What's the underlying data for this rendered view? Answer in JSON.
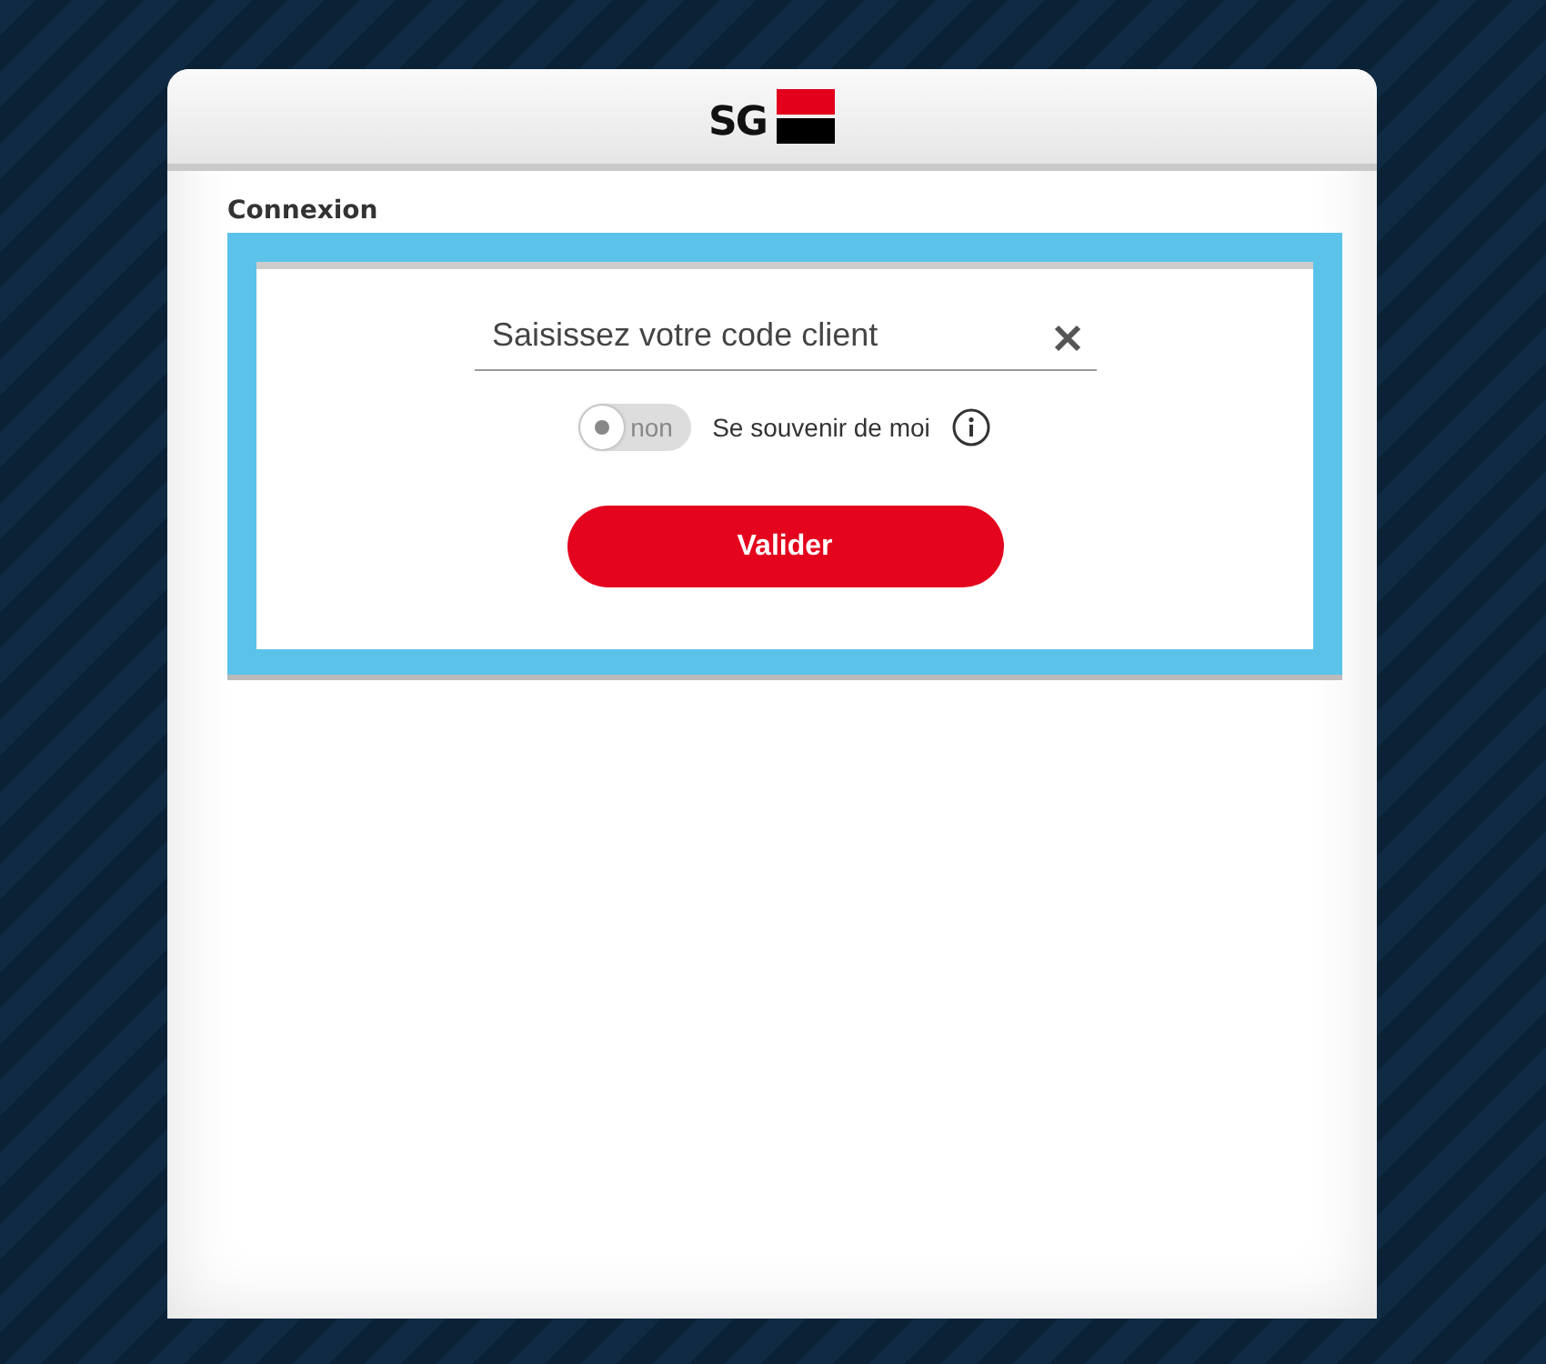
{
  "header": {
    "logo_text": "SG"
  },
  "section_title": "Connexion",
  "login": {
    "client_code": {
      "placeholder": "Saisissez votre code client"
    },
    "remember": {
      "on": false,
      "toggle_label": "non",
      "label": "Se souvenir de moi"
    },
    "submit": "Valider"
  }
}
